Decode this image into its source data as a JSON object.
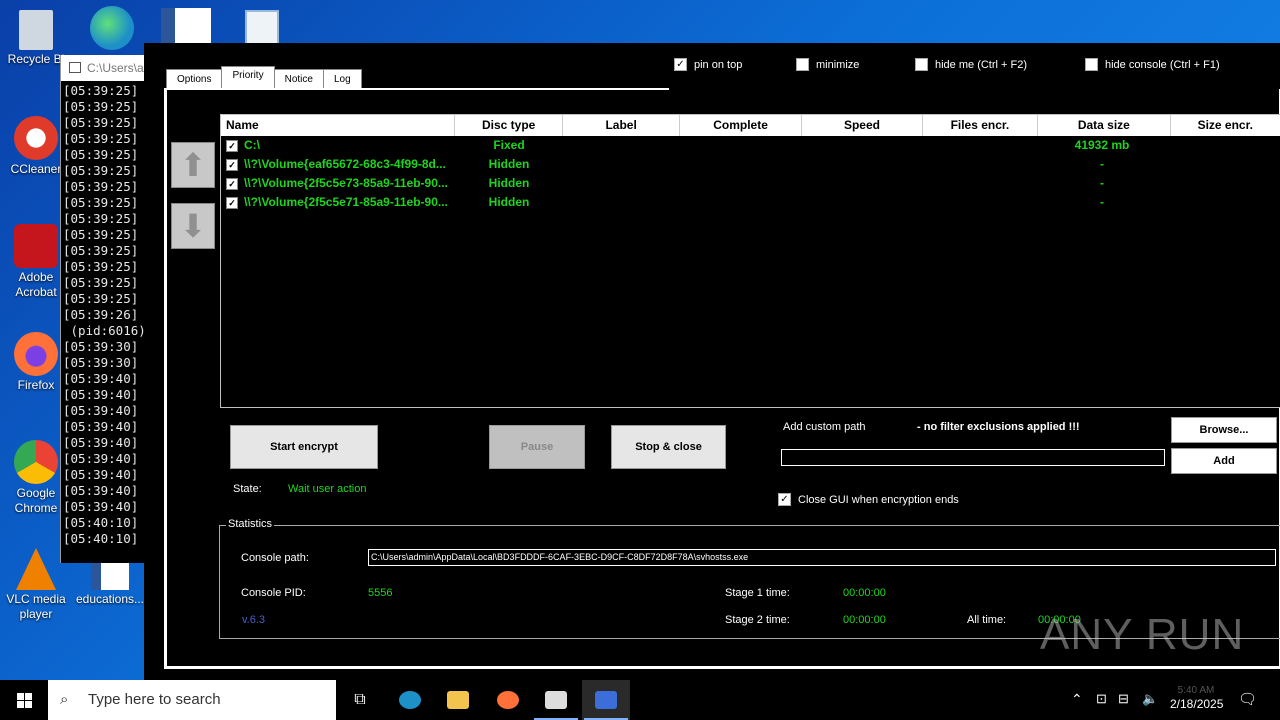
{
  "desktop": {
    "icons": [
      {
        "label": "Recycle Bi",
        "icon": "recycle-bin-icon",
        "color": "#cfd8e0"
      },
      {
        "label": "CCleaner",
        "icon": "ccleaner-icon",
        "color": "#e03a2a"
      },
      {
        "label": "Adobe Acrobat",
        "icon": "acrobat-icon",
        "color": "#c4161c"
      },
      {
        "label": "Firefox",
        "icon": "firefox-icon",
        "color": "#ff7139"
      },
      {
        "label": "Google Chrome",
        "icon": "chrome-icon",
        "color": "#34a853"
      },
      {
        "label": "VLC media player",
        "icon": "vlc-icon",
        "color": "#f08000"
      },
      {
        "label": "educations...",
        "icon": "word-doc-icon",
        "color": "#2b579a"
      }
    ],
    "top_icons": [
      {
        "icon": "edge-icon",
        "color": "#1e90c8"
      },
      {
        "icon": "word-doc-icon",
        "color": "#2b579a"
      },
      {
        "icon": "image-file-icon",
        "color": "#9ab8d8"
      }
    ]
  },
  "console": {
    "title": "C:\\Users\\a",
    "lines": [
      "[05:39:25]",
      "[05:39:25]",
      "[05:39:25]",
      "[05:39:25]",
      "[05:39:25]",
      "[05:39:25]",
      "[05:39:25]",
      "[05:39:25]",
      "[05:39:25]",
      "[05:39:25]",
      "[05:39:25]",
      "[05:39:25]",
      "[05:39:25]",
      "[05:39:25]",
      "[05:39:26]",
      " (pid:6016)",
      "[05:39:30]",
      "[05:39:30]",
      "[05:39:40]",
      "[05:39:40]",
      "[05:39:40]",
      "[05:39:40]",
      "[05:39:40]",
      "[05:39:40]",
      "[05:39:40]",
      "[05:39:40]",
      "[05:39:40]",
      "[05:40:10]",
      "[05:40:10]"
    ]
  },
  "app": {
    "tabs": [
      "Options",
      "Priority",
      "Notice",
      "Log"
    ],
    "active_tab": "Priority",
    "options": {
      "pin_on_top": "pin on top",
      "minimize": "minimize",
      "hide_me": "hide me (Ctrl + F2)",
      "hide_console": "hide console (Ctrl + F1)"
    },
    "table": {
      "columns": [
        "Name",
        "Disc type",
        "Label",
        "Complete",
        "Speed",
        "Files encr.",
        "Data size",
        "Size encr."
      ],
      "rows": [
        {
          "name": "C:\\",
          "type": "Fixed",
          "data_size": "41932 mb"
        },
        {
          "name": "\\\\?\\Volume{eaf65672-68c3-4f99-8d...",
          "type": "Hidden",
          "data_size": "-"
        },
        {
          "name": "\\\\?\\Volume{2f5c5e73-85a9-11eb-90...",
          "type": "Hidden",
          "data_size": "-"
        },
        {
          "name": "\\\\?\\Volume{2f5c5e71-85a9-11eb-90...",
          "type": "Hidden",
          "data_size": "-"
        }
      ]
    },
    "buttons": {
      "start": "Start encrypt",
      "pause": "Pause",
      "stop": "Stop & close",
      "browse": "Browse...",
      "add": "Add"
    },
    "custom_path": {
      "label": "Add custom path",
      "warning": "- no filter exclusions applied !!!",
      "value": ""
    },
    "state": {
      "label": "State:",
      "value": "Wait user action"
    },
    "close_gui": "Close GUI when encryption ends",
    "stats": {
      "title": "Statistics",
      "console_path_label": "Console path:",
      "console_path": "C:\\Users\\admin\\AppData\\Local\\BD3FDDDF-6CAF-3EBC-D9CF-C8DF72D8F78A\\svhostss.exe",
      "pid_label": "Console PID:",
      "pid": "5556",
      "stage1_label": "Stage 1 time:",
      "stage1": "00:00:00",
      "stage2_label": "Stage 2 time:",
      "stage2": "00:00:00",
      "all_label": "All time:",
      "all": "00:00:00",
      "version": "v.6.3"
    }
  },
  "taskbar": {
    "search_placeholder": "Type here to search",
    "time": "5:40 AM",
    "date": "2/18/2025"
  },
  "watermark": "ANY RUN"
}
